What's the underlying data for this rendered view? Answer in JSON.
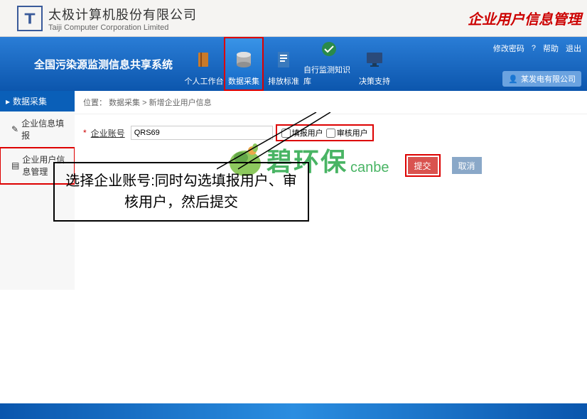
{
  "header": {
    "company_cn": "太极计算机股份有限公司",
    "company_en": "Taiji Computer Corporation Limited",
    "page_title": "企业用户信息管理"
  },
  "navbar": {
    "system_title": "全国污染源监测信息共享系统",
    "items": [
      {
        "label": "个人工作台"
      },
      {
        "label": "数据采集"
      },
      {
        "label": "排放标准"
      },
      {
        "label": "自行监测知识库"
      },
      {
        "label": "决策支持"
      }
    ],
    "right_links": {
      "modify_pwd": "修改密码",
      "help": "帮助",
      "logout": "退出"
    },
    "user_badge": "某发电有限公司"
  },
  "sidebar": {
    "header": "数据采集",
    "items": [
      {
        "label": "企业信息填报"
      },
      {
        "label": "企业用户信息管理"
      }
    ]
  },
  "breadcrumb": {
    "prefix": "位置：",
    "p1": "数据采集",
    "sep": " > ",
    "p2": "新增企业用户信息"
  },
  "form": {
    "star": "*",
    "label": "企业账号",
    "value": "QRS69",
    "cb1": "填报用户",
    "cb2": "审核用户"
  },
  "buttons": {
    "submit": "提交",
    "cancel": "取消"
  },
  "annotation": "选择企业账号:同时勾选填报用户、审核用户，然后提交",
  "watermark": {
    "main": "碧环保",
    "sub": "canbe"
  }
}
